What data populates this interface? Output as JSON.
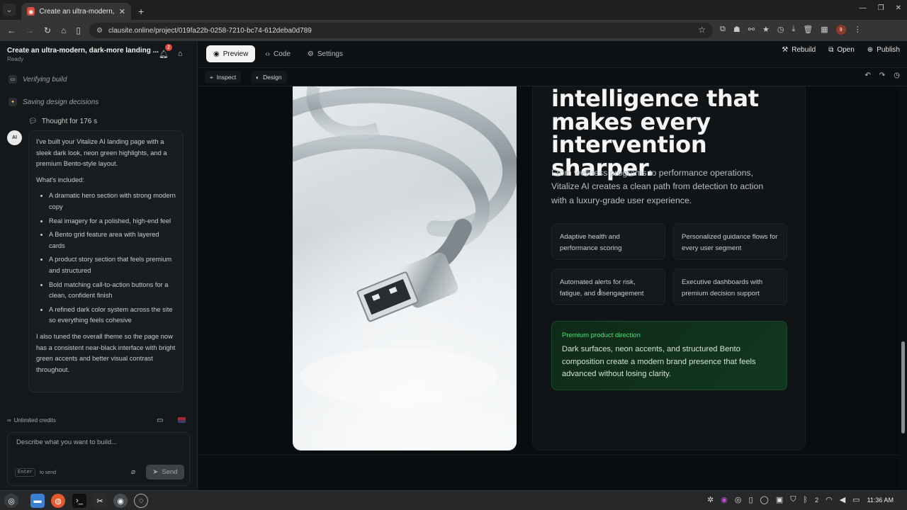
{
  "browser": {
    "tab_title": "Create an ultra-modern, dark-",
    "url": "clausite.online/project/019fa22b-0258-7210-bc74-612deba0d789",
    "profile_initial": "9"
  },
  "sidebar": {
    "project_title": "Create an ultra-modern, dark-more landing ...",
    "status": "Ready",
    "notification_count": "2",
    "steps": [
      "Verifying build",
      "Saving design decisions"
    ],
    "thought": "Thought for 176 s",
    "avatar": "AI",
    "message": {
      "intro": "I've built your Vitalize AI landing page with a sleek dark look, neon green highlights, and a premium Bento-style layout.",
      "included_heading": "What's included:",
      "items": [
        "A dramatic hero section with strong modern copy",
        "Real imagery for a polished, high-end feel",
        "A Bento grid feature area with layered cards",
        "A product story section that feels premium and structured",
        "Bold matching call-to-action buttons for a clean, confident finish",
        "A refined dark color system across the site so everything feels cohesive"
      ],
      "outro": "I also tuned the overall theme so the page now has a consistent near-black interface with bright green accents and better visual contrast throughout."
    },
    "credits": "Unlimited credits",
    "input_placeholder": "Describe what you want to build...",
    "enter_key": "Enter",
    "enter_hint": "to send",
    "send_label": "Send"
  },
  "topbar": {
    "tabs": [
      "Preview",
      "Code",
      "Settings"
    ],
    "actions": [
      "Rebuild",
      "Open",
      "Publish"
    ],
    "tools": [
      "Inspect",
      "Design"
    ]
  },
  "preview": {
    "headline": "intelligence that makes every intervention sharper.",
    "lead": "From wellness programs to performance operations, Vitalize AI creates a clean path from detection to action with a luxury-grade user experience.",
    "features": [
      "Adaptive health and performance scoring",
      "Personalized guidance flows for every user segment",
      "Automated alerts for risk, fatigue, and disengagement",
      "Executive dashboards with premium decision support"
    ],
    "callout_tag": "Premium product direction",
    "callout_body": "Dark surfaces, neon accents, and structured Bento composition create a modern brand presence that feels advanced without losing clarity."
  },
  "taskbar": {
    "clock": "11:36 AM",
    "tray_count": "2"
  },
  "colors": {
    "accent": "#4be07a",
    "background": "#0a0d0f"
  }
}
